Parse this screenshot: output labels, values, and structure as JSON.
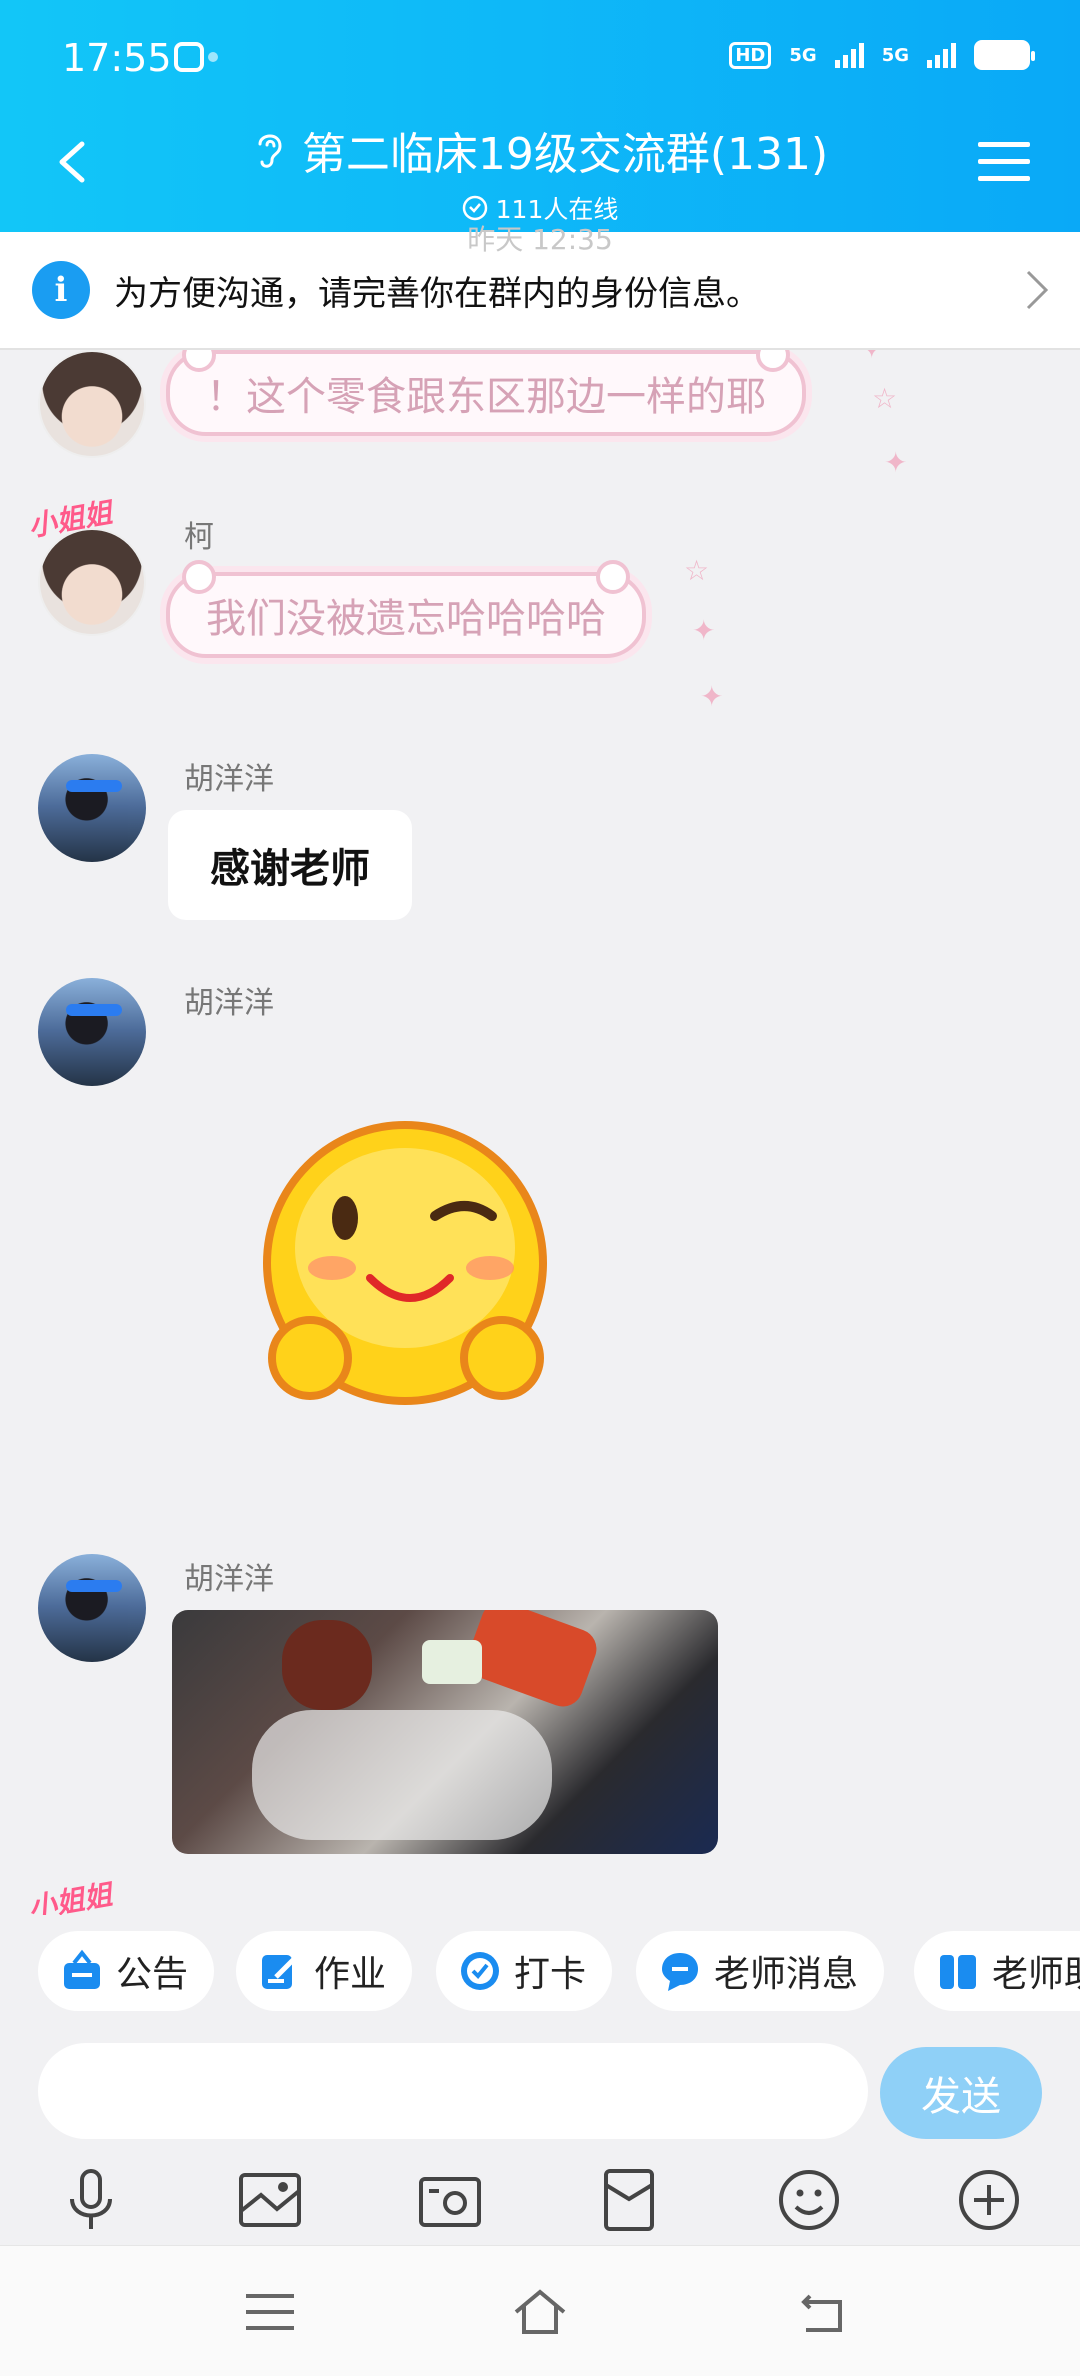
{
  "status_bar": {
    "time": "17:55",
    "indicators": [
      "HD",
      "5G",
      "5G"
    ]
  },
  "header": {
    "title": "第二临床19级交流群(131)",
    "online": "111人在线"
  },
  "banner": {
    "time_hint": "昨天 12:35",
    "text": "为方便沟通，请完善你在群内的身份信息。"
  },
  "messages": [
    {
      "name": "柯",
      "text": "！这个零食跟东区那边一样的耶"
    },
    {
      "name": "柯",
      "tag": "小姐姐",
      "text": "我们没被遗忘哈哈哈哈"
    },
    {
      "name": "胡洋洋",
      "text": "感谢老师"
    },
    {
      "name": "胡洋洋",
      "sticker": "wink-emoji"
    },
    {
      "name": "胡洋洋",
      "image": "snacks-photo"
    },
    {
      "tag": "小姐姐"
    }
  ],
  "quick_tabs": [
    "公告",
    "作业",
    "打卡",
    "老师消息",
    "老师助"
  ],
  "input": {
    "placeholder": "",
    "send_label": "发送"
  },
  "toolbar": [
    "mic-icon",
    "image-icon",
    "camera-icon",
    "redpacket-icon",
    "emoji-icon",
    "plus-icon"
  ],
  "colors": {
    "header": "#0aa9f7",
    "send": "#8fd0f7",
    "bubble_border": "#f0c2d2"
  }
}
